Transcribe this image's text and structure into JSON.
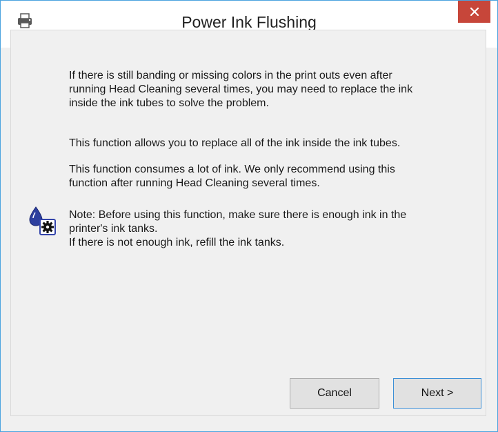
{
  "window": {
    "title": "Power Ink Flushing",
    "close_label": "×",
    "app_icon": "printer-icon"
  },
  "content": {
    "paragraph1": [
      "If there is still banding or missing colors in the print outs even after",
      "running Head Cleaning several times, you may need to replace the ink",
      "inside the ink tubes to solve the problem."
    ],
    "paragraph2": [
      "This function allows you to replace all of the ink inside the ink tubes."
    ],
    "paragraph3": [
      "This function consumes a lot of ink. We only recommend using this",
      "function after running Head Cleaning several times."
    ],
    "note": [
      "Note: Before using this function, make sure there is enough ink in the",
      "printer's ink tanks.",
      "If there is not enough ink, refill the ink tanks."
    ],
    "note_icon": "ink-settings-icon"
  },
  "buttons": {
    "cancel": "Cancel",
    "next": "Next >"
  },
  "colors": {
    "close_button": "#c7463a",
    "window_border": "#4aa3df",
    "primary_button_border": "#3c8fd6"
  }
}
